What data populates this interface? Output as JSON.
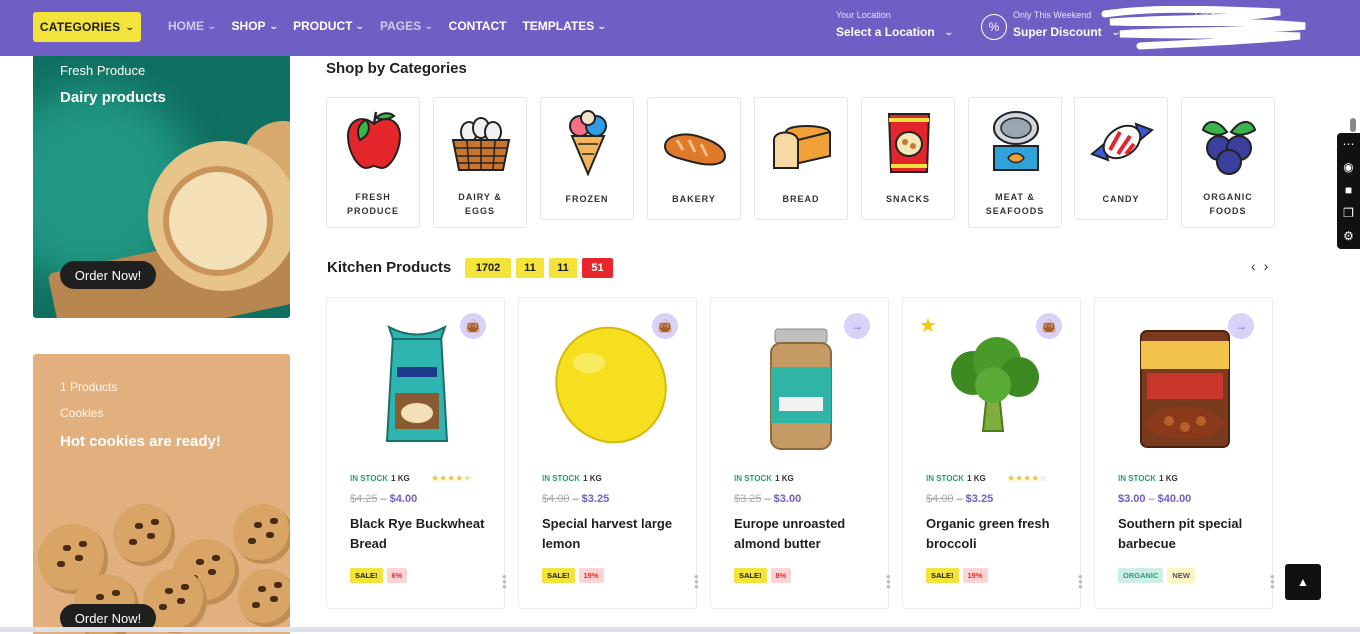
{
  "nav": {
    "categories_label": "CATEGORIES",
    "items": [
      {
        "label": "HOME",
        "has_dropdown": true
      },
      {
        "label": "SHOP",
        "has_dropdown": true
      },
      {
        "label": "PRODUCT",
        "has_dropdown": true
      },
      {
        "label": "PAGES",
        "has_dropdown": true
      },
      {
        "label": "CONTACT",
        "has_dropdown": false
      },
      {
        "label": "TEMPLATES",
        "has_dropdown": true
      }
    ],
    "location_caption": "Your Location",
    "location_value": "Select a Location",
    "promo_caption": "Only This Weekend",
    "promo_value": "Super Discount",
    "call_caption": "Call Anytime"
  },
  "banners": [
    {
      "subtitle": "Fresh Produce",
      "title": "Dairy products",
      "button": "Order Now!"
    },
    {
      "count": "1 Products",
      "subtitle": "Cookies",
      "title": "Hot cookies are ready!",
      "button": "Order Now!"
    }
  ],
  "categories_section": {
    "title": "Shop by Categories",
    "items": [
      {
        "line1": "FRESH",
        "line2": "PRODUCE",
        "icon": "apple-icon"
      },
      {
        "line1": "DAIRY &",
        "line2": "EGGS",
        "icon": "egg-basket-icon"
      },
      {
        "line1": "FROZEN",
        "line2": "",
        "icon": "ice-cream-icon"
      },
      {
        "line1": "BAKERY",
        "line2": "",
        "icon": "baguette-icon"
      },
      {
        "line1": "BREAD",
        "line2": "",
        "icon": "bread-loaf-icon"
      },
      {
        "line1": "SNACKS",
        "line2": "",
        "icon": "snack-bag-icon"
      },
      {
        "line1": "MEAT &",
        "line2": "SEAFOODS",
        "icon": "tin-can-icon"
      },
      {
        "line1": "CANDY",
        "line2": "",
        "icon": "candy-icon"
      },
      {
        "line1": "ORGANIC",
        "line2": "FOODS",
        "icon": "blueberry-icon"
      }
    ]
  },
  "kitchen": {
    "title": "Kitchen Products",
    "countdown": [
      "1702",
      "11",
      "11",
      "51"
    ]
  },
  "products": [
    {
      "stock": "IN STOCK",
      "unit": "1 KG",
      "old_price": "$4.25",
      "price": "$4.00",
      "name": "Black Rye Buckwheat Bread",
      "badges": [
        "SALE!",
        "6%"
      ],
      "rating": 4.5,
      "action": "bag"
    },
    {
      "stock": "IN STOCK",
      "unit": "1 KG",
      "old_price": "$4.00",
      "price": "$3.25",
      "name": "Special harvest large lemon",
      "badges": [
        "SALE!",
        "19%"
      ],
      "action": "bag"
    },
    {
      "stock": "IN STOCK",
      "unit": "1 KG",
      "old_price": "$3.25",
      "price": "$3.00",
      "name": "Europe unroasted almond butter",
      "badges": [
        "SALE!",
        "8%"
      ],
      "action": "arrow"
    },
    {
      "stock": "IN STOCK",
      "unit": "1 KG",
      "old_price": "$4.00",
      "price": "$3.25",
      "name": "Organic green fresh broccoli",
      "badges": [
        "SALE!",
        "19%"
      ],
      "rating": 4,
      "featured": true,
      "action": "bag"
    },
    {
      "stock": "IN STOCK",
      "unit": "1 KG",
      "old_price": "",
      "price_from": "$3.00",
      "price": "$40.00",
      "name": "Southern pit special barbecue",
      "badges": [
        "ORGANIC",
        "NEW"
      ],
      "action": "arrow"
    }
  ],
  "colors": {
    "brand": "#6f5fc4",
    "accent": "#f4e33a",
    "sale_red": "#e8262b",
    "stock_green": "#2f9d74"
  }
}
